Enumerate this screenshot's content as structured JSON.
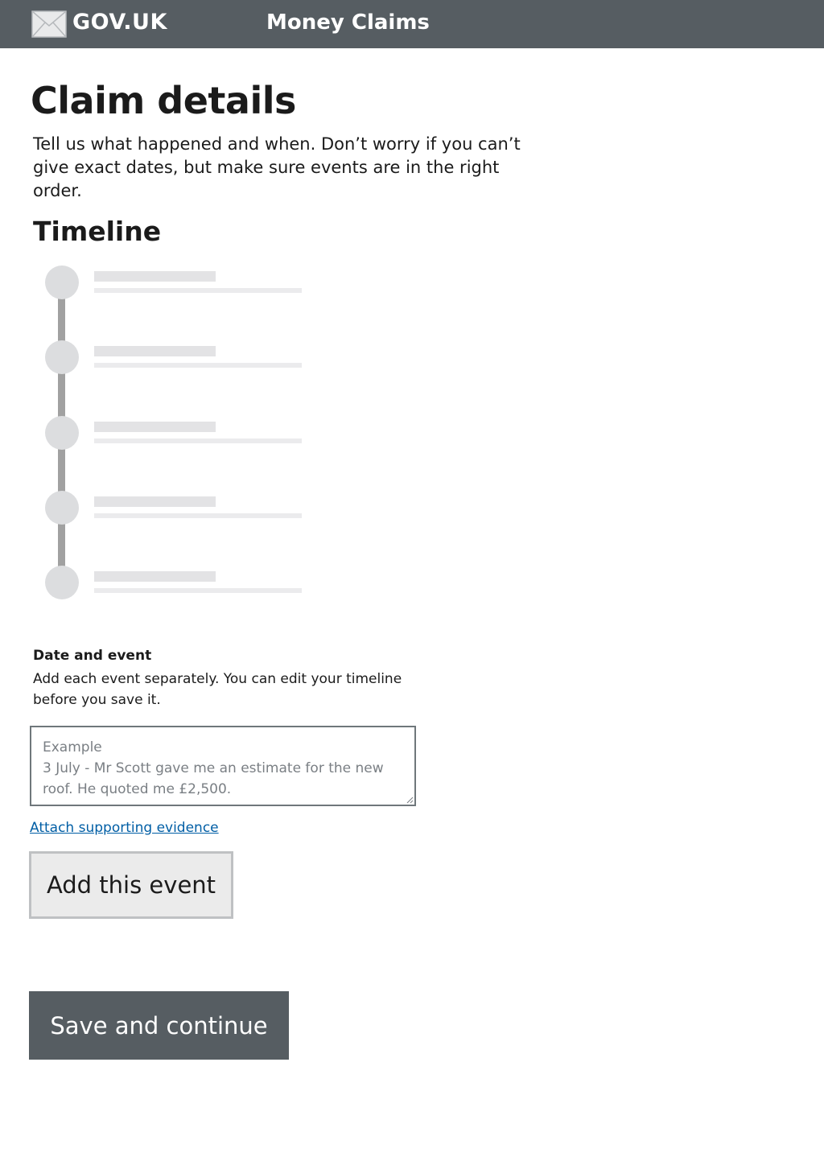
{
  "header": {
    "logo_text": "GOV.UK",
    "logo_icon": "envelope-icon",
    "service_name": "Money Claims",
    "background_color": "#565d62"
  },
  "page": {
    "title": "Claim details",
    "intro_line1": "Tell us what happened and when. Don’t worry if you can’t",
    "intro_line2": "give exact dates, but make sure events are in the right order."
  },
  "timeline": {
    "heading": "Timeline",
    "placeholder_item_count": 5
  },
  "event_field": {
    "label": "Date and event",
    "hint": "Add each event separately. You can edit your timeline before you save it.",
    "value": "",
    "placeholder_lines": [
      "Example",
      "3 July - Mr Scott gave me an estimate for the new",
      "roof. He quoted me £2,500."
    ]
  },
  "links": {
    "attach_evidence": "Attach supporting evidence",
    "link_color": "#005ea5"
  },
  "buttons": {
    "add_event": "Add this event",
    "save_continue": "Save and continue",
    "save_continue_color": "#565d62"
  }
}
